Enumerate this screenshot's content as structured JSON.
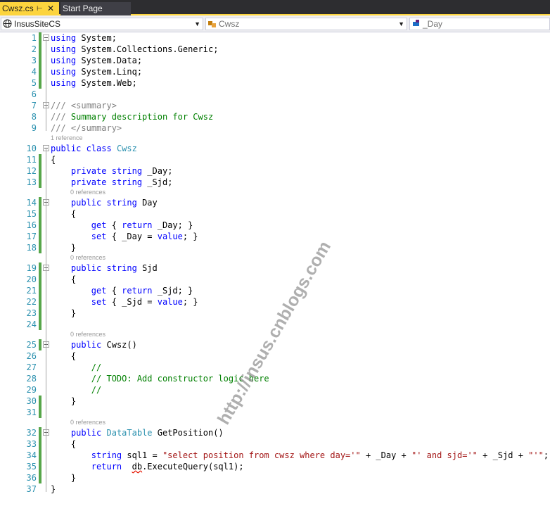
{
  "tabs": [
    {
      "label": "Cwsz.cs",
      "active": true
    },
    {
      "label": "Start Page",
      "active": false
    }
  ],
  "icons": {
    "pin": "pin-icon",
    "close": "close-icon"
  },
  "nav": {
    "project": "InsusSiteCS",
    "type": "Cwsz",
    "member": "_Day"
  },
  "colors": {
    "tab_active": "#fcd43e",
    "tab_bar": "#2d2d30",
    "keyword": "#0000ff",
    "type": "#2b91af",
    "string": "#a31515",
    "comment": "#008000",
    "change_margin": "#57a64a"
  },
  "code_lines": [
    {
      "n": "1",
      "tokens": [
        {
          "t": "using",
          "c": "kw"
        },
        {
          "t": " System;"
        }
      ]
    },
    {
      "n": "2",
      "tokens": [
        {
          "t": "using",
          "c": "kw"
        },
        {
          "t": " System.Collections.Generic;"
        }
      ]
    },
    {
      "n": "3",
      "tokens": [
        {
          "t": "using",
          "c": "kw"
        },
        {
          "t": " System.Data;"
        }
      ]
    },
    {
      "n": "4",
      "tokens": [
        {
          "t": "using",
          "c": "kw"
        },
        {
          "t": " System.Linq;"
        }
      ]
    },
    {
      "n": "5",
      "tokens": [
        {
          "t": "using",
          "c": "kw"
        },
        {
          "t": " System.Web;"
        }
      ]
    },
    {
      "n": "6",
      "tokens": []
    },
    {
      "n": "7",
      "tokens": [
        {
          "t": "/// ",
          "c": "dc"
        },
        {
          "t": "<summary>",
          "c": "dc"
        }
      ]
    },
    {
      "n": "8",
      "tokens": [
        {
          "t": "/// ",
          "c": "dc"
        },
        {
          "t": "Summary description for Cwsz",
          "c": "cm"
        }
      ]
    },
    {
      "n": "9",
      "tokens": [
        {
          "t": "/// ",
          "c": "dc"
        },
        {
          "t": "</summary>",
          "c": "dc"
        }
      ]
    },
    {
      "n": "10",
      "lens": "1 reference",
      "tokens": [
        {
          "t": "public",
          "c": "kw"
        },
        {
          "t": " "
        },
        {
          "t": "class",
          "c": "kw"
        },
        {
          "t": " "
        },
        {
          "t": "Cwsz",
          "c": "ty"
        }
      ]
    },
    {
      "n": "11",
      "tokens": [
        {
          "t": "{"
        }
      ]
    },
    {
      "n": "12",
      "tokens": [
        {
          "t": "    "
        },
        {
          "t": "private",
          "c": "kw"
        },
        {
          "t": " "
        },
        {
          "t": "string",
          "c": "kw"
        },
        {
          "t": " _Day;"
        }
      ]
    },
    {
      "n": "13",
      "tokens": [
        {
          "t": "    "
        },
        {
          "t": "private",
          "c": "kw"
        },
        {
          "t": " "
        },
        {
          "t": "string",
          "c": "kw"
        },
        {
          "t": " _Sjd;"
        }
      ]
    },
    {
      "n": "14",
      "lens": "0 references",
      "tokens": [
        {
          "t": "    "
        },
        {
          "t": "public",
          "c": "kw"
        },
        {
          "t": " "
        },
        {
          "t": "string",
          "c": "kw"
        },
        {
          "t": " Day"
        }
      ]
    },
    {
      "n": "15",
      "tokens": [
        {
          "t": "    {"
        }
      ]
    },
    {
      "n": "16",
      "tokens": [
        {
          "t": "        "
        },
        {
          "t": "get",
          "c": "kw"
        },
        {
          "t": " { "
        },
        {
          "t": "return",
          "c": "kw"
        },
        {
          "t": " _Day; }"
        }
      ]
    },
    {
      "n": "17",
      "tokens": [
        {
          "t": "        "
        },
        {
          "t": "set",
          "c": "kw"
        },
        {
          "t": " { _Day = "
        },
        {
          "t": "value",
          "c": "kw"
        },
        {
          "t": "; }"
        }
      ]
    },
    {
      "n": "18",
      "tokens": [
        {
          "t": "    }"
        }
      ]
    },
    {
      "n": "19",
      "lens": "0 references",
      "tokens": [
        {
          "t": "    "
        },
        {
          "t": "public",
          "c": "kw"
        },
        {
          "t": " "
        },
        {
          "t": "string",
          "c": "kw"
        },
        {
          "t": " Sjd"
        }
      ]
    },
    {
      "n": "20",
      "tokens": [
        {
          "t": "    {"
        }
      ]
    },
    {
      "n": "21",
      "tokens": [
        {
          "t": "        "
        },
        {
          "t": "get",
          "c": "kw"
        },
        {
          "t": " { "
        },
        {
          "t": "return",
          "c": "kw"
        },
        {
          "t": " _Sjd; }"
        }
      ]
    },
    {
      "n": "22",
      "tokens": [
        {
          "t": "        "
        },
        {
          "t": "set",
          "c": "kw"
        },
        {
          "t": " { _Sjd = "
        },
        {
          "t": "value",
          "c": "kw"
        },
        {
          "t": "; }"
        }
      ]
    },
    {
      "n": "23",
      "tokens": [
        {
          "t": "    }"
        }
      ]
    },
    {
      "n": "24",
      "tokens": []
    },
    {
      "n": "25",
      "lens": "0 references",
      "tokens": [
        {
          "t": "    "
        },
        {
          "t": "public",
          "c": "kw"
        },
        {
          "t": " Cwsz()"
        }
      ]
    },
    {
      "n": "26",
      "tokens": [
        {
          "t": "    {"
        }
      ]
    },
    {
      "n": "27",
      "tokens": [
        {
          "t": "        "
        },
        {
          "t": "//",
          "c": "cm"
        }
      ]
    },
    {
      "n": "28",
      "tokens": [
        {
          "t": "        "
        },
        {
          "t": "// TODO: Add constructor logic here",
          "c": "cm"
        }
      ]
    },
    {
      "n": "29",
      "tokens": [
        {
          "t": "        "
        },
        {
          "t": "//",
          "c": "cm"
        }
      ]
    },
    {
      "n": "30",
      "tokens": [
        {
          "t": "    }"
        }
      ]
    },
    {
      "n": "31",
      "tokens": []
    },
    {
      "n": "32",
      "lens": "0 references",
      "tokens": [
        {
          "t": "    "
        },
        {
          "t": "public",
          "c": "kw"
        },
        {
          "t": " "
        },
        {
          "t": "DataTable",
          "c": "ty"
        },
        {
          "t": " GetPosition()"
        }
      ]
    },
    {
      "n": "33",
      "tokens": [
        {
          "t": "    {"
        }
      ]
    },
    {
      "n": "34",
      "tokens": [
        {
          "t": "        "
        },
        {
          "t": "string",
          "c": "kw"
        },
        {
          "t": " sql1 = "
        },
        {
          "t": "\"select position from cwsz where day='\"",
          "c": "st"
        },
        {
          "t": " + _Day + "
        },
        {
          "t": "\"' and sjd='\"",
          "c": "st"
        },
        {
          "t": " + _Sjd + "
        },
        {
          "t": "\"'\"",
          "c": "st"
        },
        {
          "t": ";"
        }
      ]
    },
    {
      "n": "35",
      "tokens": [
        {
          "t": "        "
        },
        {
          "t": "return",
          "c": "kw"
        },
        {
          "t": "  "
        },
        {
          "t": "db",
          "c": "sq"
        },
        {
          "t": ".ExecuteQuery(sql1);"
        }
      ]
    },
    {
      "n": "36",
      "tokens": [
        {
          "t": "    }"
        }
      ]
    },
    {
      "n": "37",
      "tokens": [
        {
          "t": "}"
        }
      ]
    }
  ],
  "watermark": "http://insus.cnblogs.com"
}
